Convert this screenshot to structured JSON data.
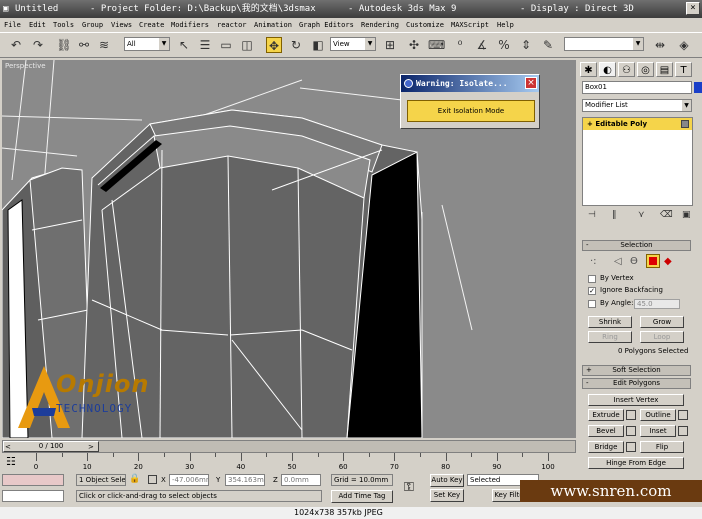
{
  "window": {
    "doc": "Untitled",
    "project": "- Project Folder: D:\\Backup\\我的文档\\3dsmax",
    "app": "- Autodesk 3ds Max 9",
    "display": "- Display : Direct 3D"
  },
  "menu": [
    "File",
    "Edit",
    "Tools",
    "Group",
    "Views",
    "Create",
    "Modifiers",
    "reactor",
    "Animation",
    "Graph Editors",
    "Rendering",
    "Customize",
    "MAXScript",
    "Help"
  ],
  "toolbar": {
    "selection_filter": "All",
    "ref_coord": "View"
  },
  "viewport": {
    "label": "Perspective"
  },
  "warning": {
    "title": "Warning: Isolate...",
    "exit_label": "Exit Isolation Mode"
  },
  "command_panel": {
    "object_name": "Box01",
    "object_color": "#1a3fc8",
    "modifier_list": "Modifier List",
    "stack_item": "Editable Poly",
    "selection": {
      "title": "Selection",
      "by_vertex": "By Vertex",
      "ignore_backfacing": "Ignore Backfacing",
      "by_angle": "By Angle:",
      "angle_value": "45.0",
      "shrink": "Shrink",
      "grow": "Grow",
      "ring": "Ring",
      "loop": "Loop",
      "status": "0 Polygons Selected"
    },
    "soft_selection": "Soft Selection",
    "edit_polygons": {
      "title": "Edit Polygons",
      "insert_vertex": "Insert Vertex",
      "extrude": "Extrude",
      "outline": "Outline",
      "bevel": "Bevel",
      "inset": "Inset",
      "bridge": "Bridge",
      "flip": "Flip",
      "hinge": "Hinge From Edge"
    }
  },
  "timeline": {
    "slider_label": "0 / 100",
    "ticks": [
      "0",
      "10",
      "20",
      "30",
      "40",
      "50",
      "60",
      "70",
      "80",
      "90",
      "100"
    ]
  },
  "status": {
    "object_count": "1 Object Sele",
    "x": "-47.006mm",
    "y": "354.163mm",
    "z": "0.0mm",
    "grid": "Grid = 10.0mm",
    "auto_key": "Auto Key",
    "selected": "Selected",
    "set_key": "Set Key",
    "key_filters": "Key Filte",
    "add_time_tag": "Add Time Tag",
    "prompt": "Click or click-and-drag to select objects",
    "x_label": "X",
    "y_label": "Y",
    "z_label": "Z"
  },
  "logo": {
    "brand": "Onjion",
    "subtitle": "TECHNOLOGY"
  },
  "footer": {
    "info": "1024x738  357kb  JPEG",
    "watermark": "www.snren.com"
  }
}
